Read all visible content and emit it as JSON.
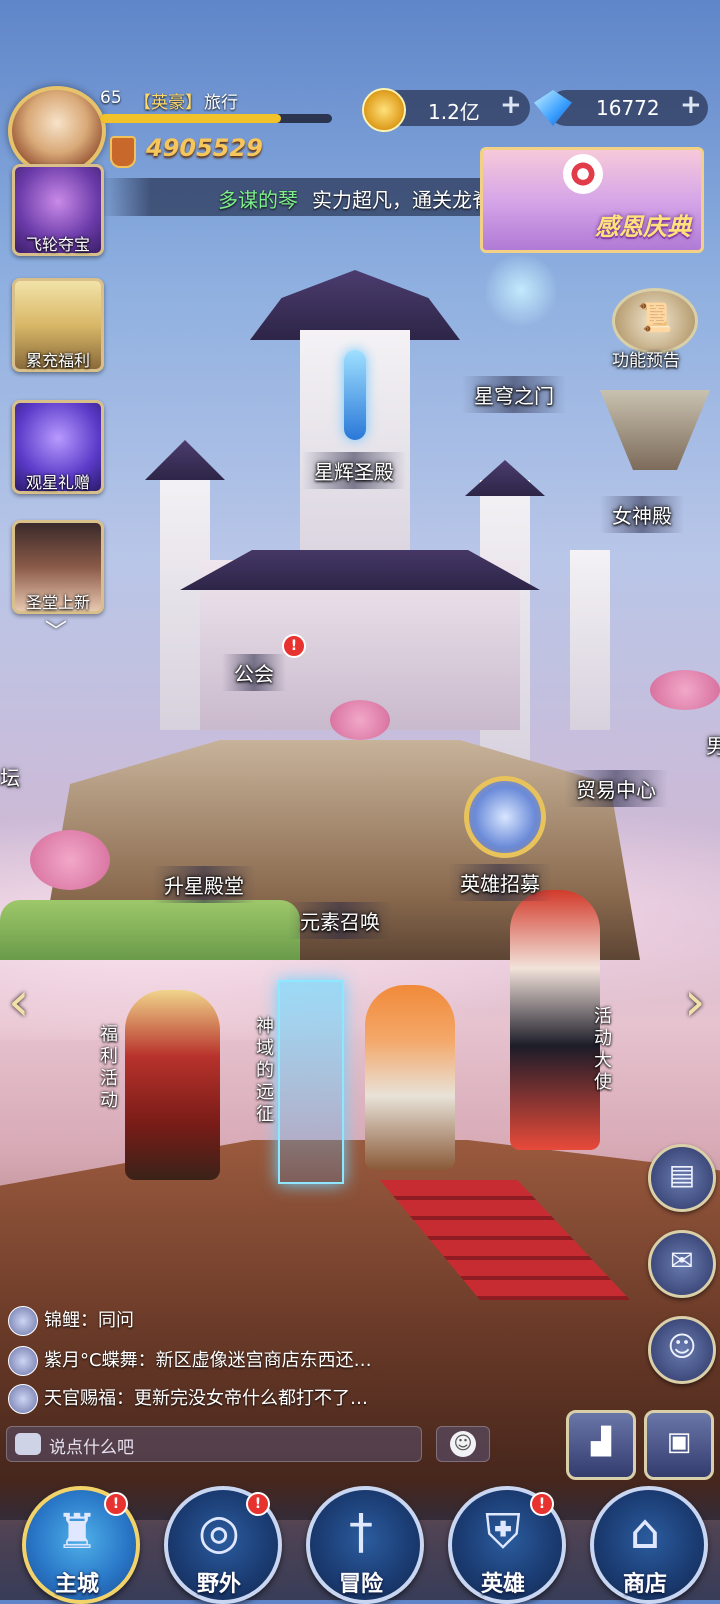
{
  "player": {
    "level": "65",
    "title_tag": "【英豪】",
    "title_name": "旅行",
    "exp_fraction": 0.78,
    "power": "4905529"
  },
  "currency": {
    "coins": "1.2亿",
    "gems": "16772",
    "plus": "+"
  },
  "marquee": {
    "player_name": "多谋的琴",
    "message": "实力超凡，通关龙脊之塔"
  },
  "event_banner": {
    "label": "感恩庆典"
  },
  "left_menu": {
    "items": [
      {
        "label": "飞轮夺宝"
      },
      {
        "label": "累充福利"
      },
      {
        "label": "观星礼赠"
      },
      {
        "label": "圣堂上新"
      }
    ],
    "up_chevron": "︿",
    "down_chevron": "﹀"
  },
  "feature_preview": {
    "label": "功能预告"
  },
  "buildings": {
    "star_palace": "星辉圣殿",
    "star_gate": "星穹之门",
    "goddess_hall": "女神殿",
    "guild": "公会",
    "altar_partial": "坛",
    "trade_center": "贸易中心",
    "star_rise_hall": "升星殿堂",
    "element_summon": "元素召唤",
    "hero_recruit": "英雄招募",
    "partial_right": "男"
  },
  "npcs": {
    "welfare": "福利活动",
    "expedition": "神域的远征",
    "ambassador": "活动大使"
  },
  "badge_mark": "!",
  "scene_arrows": {
    "left": "‹",
    "right": "›"
  },
  "chat": {
    "lines": [
      {
        "name": "锦鲤",
        "sep": "：",
        "text": "同问"
      },
      {
        "name": "紫月°C蝶舞",
        "sep": "：",
        "text": "新区虚像迷宫商店东西还…"
      },
      {
        "name": "天官赐福",
        "sep": "：",
        "text": "更新完没女帝什么都打不了…"
      }
    ],
    "placeholder": "说点什么吧"
  },
  "right_buttons": [
    "scroll-icon",
    "mail-icon",
    "friends-icon",
    "ranking-icon",
    "backpack-icon"
  ],
  "bottom_nav": [
    {
      "label": "主城",
      "icon": "castle-icon",
      "active": true,
      "badge": true
    },
    {
      "label": "野外",
      "icon": "portal-icon",
      "active": false,
      "badge": true
    },
    {
      "label": "冒险",
      "icon": "sword-icon",
      "active": false,
      "badge": false
    },
    {
      "label": "英雄",
      "icon": "helmet-icon",
      "active": false,
      "badge": true
    },
    {
      "label": "商店",
      "icon": "shop-icon",
      "active": false,
      "badge": false
    }
  ]
}
